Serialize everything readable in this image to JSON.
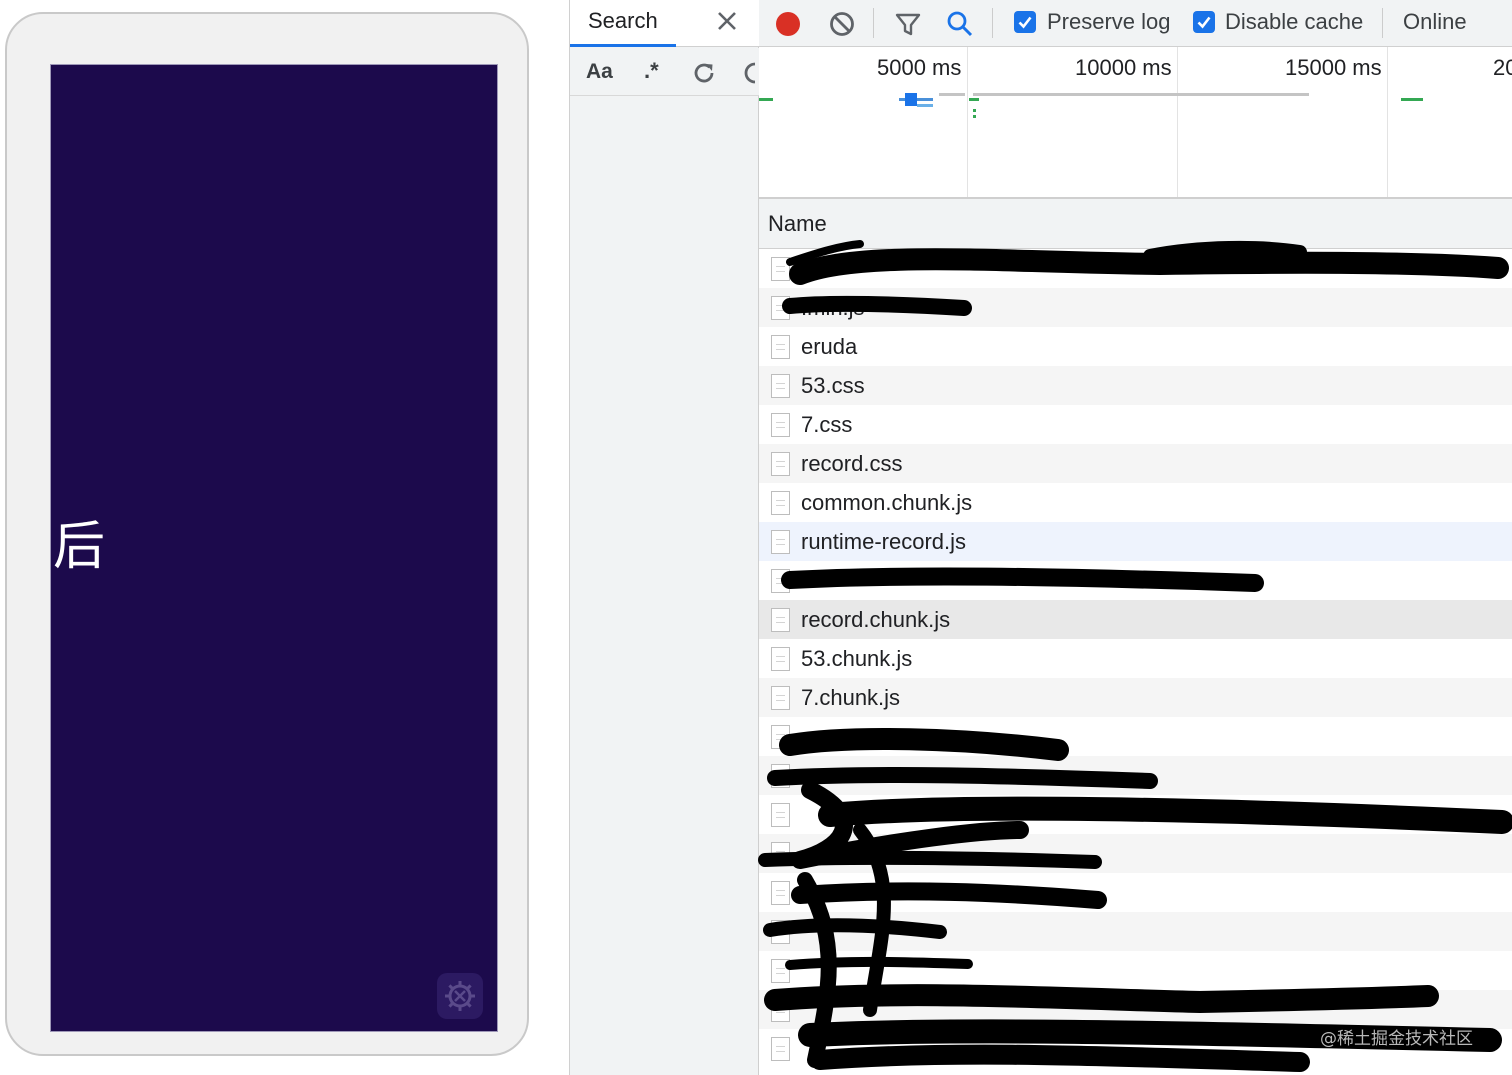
{
  "device": {
    "screen_char": "后",
    "screen_color": "#1c0a4c",
    "settings_icon": "gear-icon"
  },
  "search_panel": {
    "tab_label": "Search",
    "case_label": "Aa",
    "regex_label": ".*"
  },
  "toolbar": {
    "preserve_log_label": "Preserve log",
    "preserve_log_checked": true,
    "disable_cache_label": "Disable cache",
    "disable_cache_checked": true,
    "throttle_label": "Online",
    "record_color": "#d93025",
    "accent_color": "#1a73e8"
  },
  "overview": {
    "ticks": [
      "5000 ms",
      "10000 ms",
      "15000 ms",
      "20"
    ]
  },
  "table": {
    "header_name": "Name",
    "rows": [
      {
        "name": "",
        "redacted": true
      },
      {
        "name": ".min.js",
        "redacted": true
      },
      {
        "name": "eruda"
      },
      {
        "name": "53.css"
      },
      {
        "name": "7.css"
      },
      {
        "name": "record.css"
      },
      {
        "name": "common.chunk.js"
      },
      {
        "name": "runtime-record.js"
      },
      {
        "name": "",
        "redacted": true
      },
      {
        "name": "record.chunk.js"
      },
      {
        "name": "53.chunk.js"
      },
      {
        "name": "7.chunk.js"
      },
      {
        "name": "",
        "redacted": true
      },
      {
        "name": "",
        "redacted": true
      },
      {
        "name": "",
        "redacted": true
      },
      {
        "name": "",
        "redacted": true
      },
      {
        "name": "",
        "redacted": true
      },
      {
        "name": "",
        "redacted": true
      },
      {
        "name": "",
        "redacted": true
      },
      {
        "name": "",
        "redacted": true
      },
      {
        "name": "",
        "redacted": true
      }
    ]
  },
  "watermark": "@稀土掘金技术社区"
}
